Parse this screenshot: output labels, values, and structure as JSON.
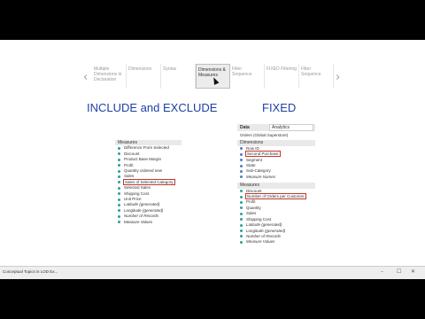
{
  "nav": {
    "prev_arrow": "‹",
    "next_arrow": "›",
    "tabs": [
      {
        "label": "Multiple Dimensions in Declaration",
        "active": false
      },
      {
        "label": "Dimensions",
        "active": false
      },
      {
        "label": "Syntax",
        "active": false
      },
      {
        "label": "Dimensions & Measures",
        "active": true
      },
      {
        "label": "Filter Sequence",
        "active": false
      },
      {
        "label": "FIXED Filtering",
        "active": false
      },
      {
        "label": "Filter Sequence",
        "active": false
      }
    ]
  },
  "left_heading": "INCLUDE and EXCLUDE",
  "right_heading": "FIXED",
  "left_panel": {
    "section": "Measures",
    "items": [
      {
        "label": "Difference From Selected",
        "icon_color": "#2aa198"
      },
      {
        "label": "Discount",
        "icon_color": "#2aa198"
      },
      {
        "label": "Product Base Margin",
        "icon_color": "#2aa198"
      },
      {
        "label": "Profit",
        "icon_color": "#2aa198"
      },
      {
        "label": "Quantity ordered new",
        "icon_color": "#2aa198"
      },
      {
        "label": "Sales",
        "icon_color": "#2aa198"
      },
      {
        "label": "Sales of Selected Category",
        "icon_color": "#2aa198",
        "highlight": true
      },
      {
        "label": "Selected Sales",
        "icon_color": "#2aa198"
      },
      {
        "label": "Shipping Cost",
        "icon_color": "#2aa198"
      },
      {
        "label": "Unit Price",
        "icon_color": "#2aa198"
      },
      {
        "label": "Latitude (generated)",
        "icon_color": "#2aa198",
        "italic": true
      },
      {
        "label": "Longitude (generated)",
        "icon_color": "#2aa198",
        "italic": true
      },
      {
        "label": "Number of Records",
        "icon_color": "#2aa198",
        "italic": true
      },
      {
        "label": "Measure Values",
        "icon_color": "#2aa198"
      }
    ]
  },
  "right_panel": {
    "tab_data": "Data",
    "tab_analytics": "Analytics",
    "source": "Orders (Global Superstore)",
    "dimensions_label": "Dimensions",
    "dimensions": [
      {
        "label": "Row ID",
        "icon_color": "#4a7fc1"
      },
      {
        "label": "Second Purchase",
        "icon_color": "#4a7fc1",
        "highlight": true
      },
      {
        "label": "Segment",
        "icon_color": "#4a7fc1"
      },
      {
        "label": "State",
        "icon_color": "#4a7fc1"
      },
      {
        "label": "Sub-Category",
        "icon_color": "#4a7fc1"
      },
      {
        "label": "Measure Names",
        "icon_color": "#4a7fc1",
        "italic": true
      }
    ],
    "measures_label": "Measures",
    "measures": [
      {
        "label": "Discount",
        "icon_color": "#2aa198"
      },
      {
        "label": "Number of Orders per Customer",
        "icon_color": "#2aa198",
        "highlight": true
      },
      {
        "label": "Profit",
        "icon_color": "#2aa198"
      },
      {
        "label": "Quantity",
        "icon_color": "#2aa198"
      },
      {
        "label": "Sales",
        "icon_color": "#2aa198"
      },
      {
        "label": "Shipping Cost",
        "icon_color": "#2aa198"
      },
      {
        "label": "Latitude (generated)",
        "icon_color": "#2aa198",
        "italic": true
      },
      {
        "label": "Longitude (generated)",
        "icon_color": "#2aa198",
        "italic": true
      },
      {
        "label": "Number of Records",
        "icon_color": "#2aa198",
        "italic": true
      },
      {
        "label": "Measure Values",
        "icon_color": "#2aa198",
        "italic": true
      }
    ]
  },
  "taskbar": {
    "title": "Conceptual Topics in LOD Ex..."
  },
  "colors": {
    "heading": "#1f3fa8",
    "highlight": "#c0392b"
  }
}
